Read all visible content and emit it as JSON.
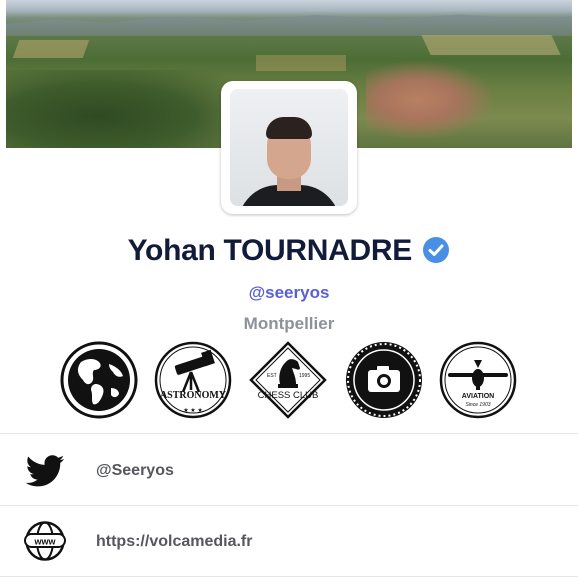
{
  "profile": {
    "name": "Yohan TOURNADRE",
    "handle": "@seeryos",
    "location": "Montpellier",
    "verified": true
  },
  "badges": [
    {
      "icon": "globe-icon",
      "text": ""
    },
    {
      "icon": "telescope-icon",
      "text": "ASTRONOMY",
      "subtext": ""
    },
    {
      "icon": "chess-knight-icon",
      "text": "CHESS CLUB",
      "left_small": "EST",
      "right_small": "1995"
    },
    {
      "icon": "camera-icon",
      "text": ""
    },
    {
      "icon": "airplane-icon",
      "text": "AVIATION",
      "subtext": "Since 1903"
    }
  ],
  "links": [
    {
      "icon": "twitter-bird-icon",
      "text": "@Seeryos"
    },
    {
      "icon": "www-globe-icon",
      "text": "https://volcamedia.fr"
    }
  ],
  "colors": {
    "name": "#131b3a",
    "handle": "#5a5fd6",
    "location": "#8f919a",
    "verified": "#4a8fe6"
  }
}
